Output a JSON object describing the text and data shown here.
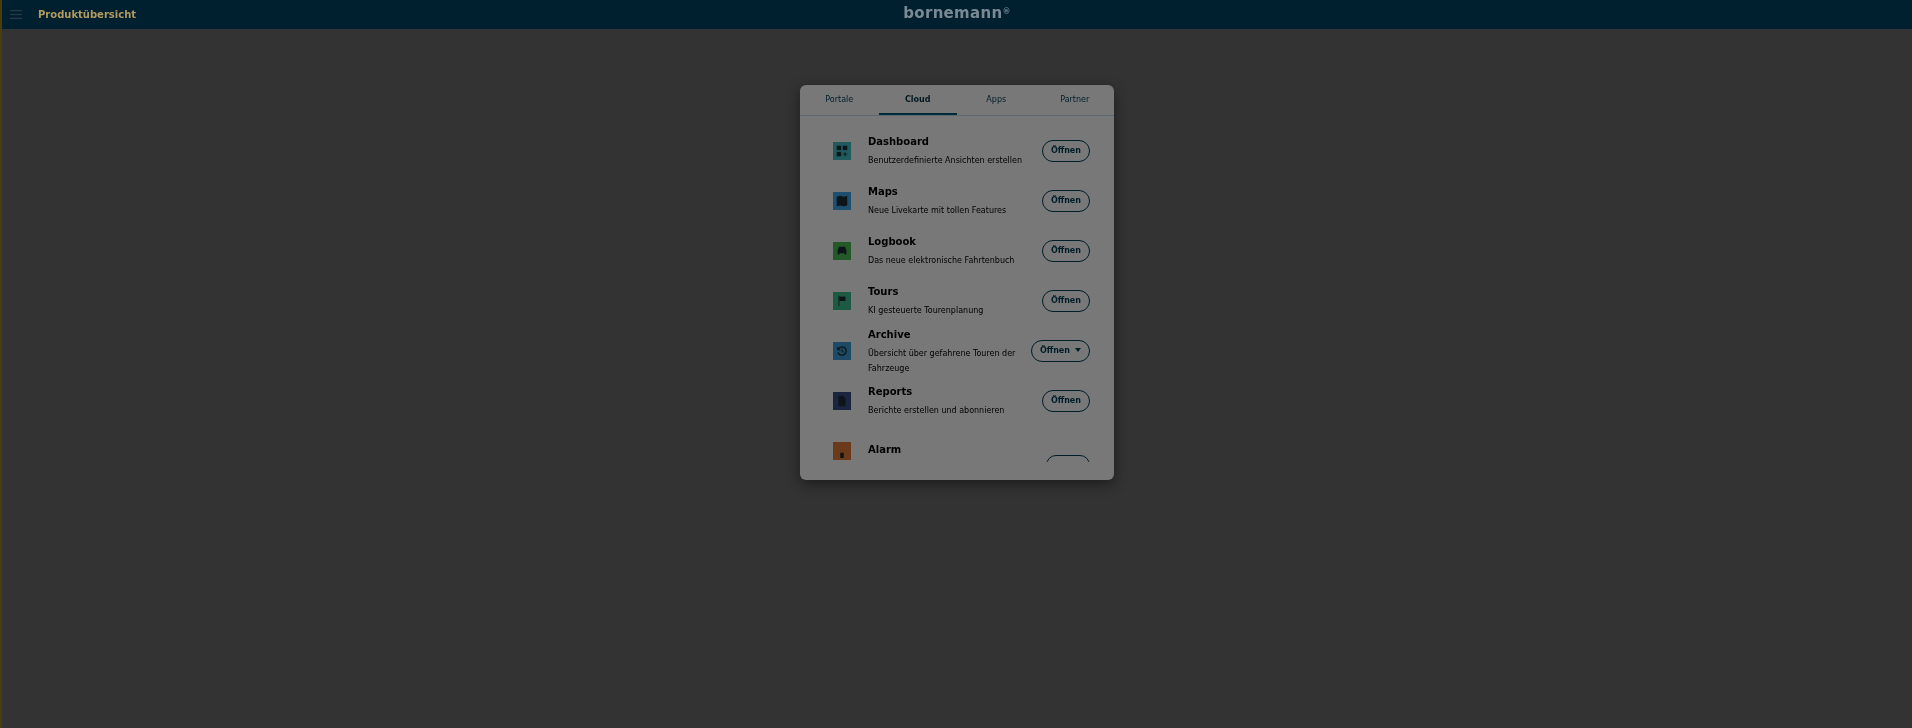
{
  "header": {
    "title": "Produktübersicht",
    "logo": "bornemann",
    "logo_mark": "®"
  },
  "tabs": [
    {
      "label": "Portale",
      "selected": false
    },
    {
      "label": "Cloud",
      "selected": true
    },
    {
      "label": "Apps",
      "selected": false
    },
    {
      "label": "Partner",
      "selected": false
    }
  ],
  "products": [
    {
      "kind": "grid",
      "color": "#1f5a5c",
      "title": "Dashboard",
      "description": "Benutzerdefinierte Ansichten erstellen",
      "button": "Öffnen",
      "dropdown": false
    },
    {
      "kind": "map",
      "color": "#1d4f6e",
      "title": "Maps",
      "description": "Neue Livekarte mit tollen Features",
      "button": "Öffnen",
      "dropdown": false
    },
    {
      "kind": "car",
      "color": "#245a2a",
      "title": "Logbook",
      "description": "Das neue elektronische Fahrtenbuch",
      "button": "Öffnen",
      "dropdown": false
    },
    {
      "kind": "flag",
      "color": "#1d5a44",
      "title": "Tours",
      "description": "KI gesteuerte Tourenplanung",
      "button": "Öffnen",
      "dropdown": false
    },
    {
      "kind": "history",
      "color": "#1d4a66",
      "title": "Archive",
      "description": "Übersicht über gefahrene Touren der Fahrzeuge",
      "button": "Öffnen",
      "dropdown": true
    },
    {
      "kind": "document",
      "color": "#1c2540",
      "title": "Reports",
      "description": "Berichte erstellen und abonnieren",
      "button": "Öffnen",
      "dropdown": false
    },
    {
      "kind": "alarm",
      "color": "#6a3a1a",
      "title": "Alarm"
    }
  ]
}
